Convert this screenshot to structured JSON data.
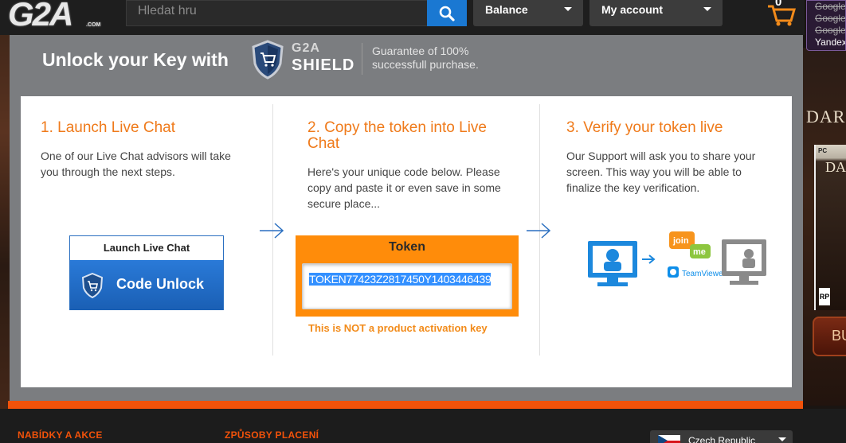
{
  "header": {
    "logo": "G2A",
    "logo_suffix": ".COM",
    "search_placeholder": "Hledat hru",
    "balance_label": "Balance",
    "account_label": "My account",
    "cart_count": "0"
  },
  "suggestions": [
    "Google",
    "Google",
    "Google",
    "Yandex"
  ],
  "side_ad": {
    "title": "DAR",
    "box_title": "DA",
    "box_platform": "PC",
    "rating": "RP",
    "buy_label": "BU"
  },
  "shield": {
    "title": "Unlock your Key with",
    "brand_top": "G2A",
    "brand_bottom": "SHIELD",
    "guarantee": "Guarantee of 100% successfull purchase."
  },
  "steps": [
    {
      "title": "1. Launch Live Chat",
      "text": "One of our Live Chat advisors will take you through the next steps."
    },
    {
      "title": "2. Copy the token into Live Chat",
      "text": "Here's your unique code below. Please copy and paste it or even save in some secure place..."
    },
    {
      "title": "3. Verify your token live",
      "text": "Our Support will ask you to share your screen. This way you will be able to finalize the key verification."
    }
  ],
  "chat_button": {
    "label": "Launch Live Chat",
    "action": "Code Unlock"
  },
  "token": {
    "label": "Token",
    "value": "TOKEN77423Z2817450Y1403446439",
    "warning": "This is NOT a product activation key"
  },
  "verify_graphic": {
    "join": "join",
    "me": "me",
    "teamviewer": "TeamViewer"
  },
  "footer": {
    "offers": "NABÍDKY A AKCE",
    "payment": "ZPŮSOBY PLACENÍ",
    "country": "Czech Republic"
  },
  "colors": {
    "accent": "#ef7a1a",
    "blue": "#1a78d2",
    "footer_bar": "#f2520a"
  }
}
